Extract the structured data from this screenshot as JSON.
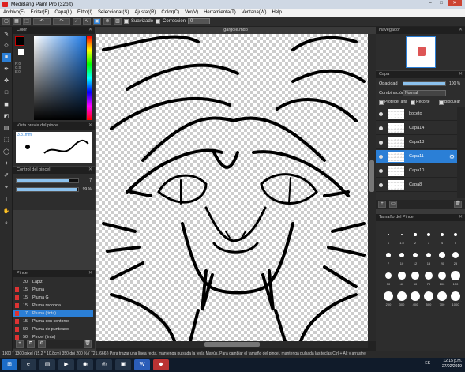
{
  "window": {
    "title": "MediBang Paint Pro (32bit)",
    "controls": [
      "–",
      "□",
      "✕"
    ]
  },
  "menu": [
    "Archivo(F)",
    "Editar(E)",
    "Capa(L)",
    "Filtro(I)",
    "Seleccionar(S)",
    "Ajustar(R)",
    "Color(C)",
    "Ver(V)",
    "Herramienta(T)",
    "Ventana(W)",
    "Help"
  ],
  "toolbar": {
    "smooth_label": "Suavizado",
    "correction_label": "Corrección",
    "correction_value": "0"
  },
  "color_panel": {
    "title": "Color",
    "hex_lines": [
      "R:0",
      "G:0",
      "B:0"
    ],
    "main_color": "#000000",
    "sub_color": "#ffffff"
  },
  "brush_preview": {
    "title": "Vista previa del pincel",
    "size": "3.31mm"
  },
  "brush_control": {
    "title": "Control del pincel",
    "size_value": "7",
    "opacity_value": "99 %",
    "size_fraction": 0.85,
    "opacity_fraction": 0.99
  },
  "brush_list": {
    "title": "Pincel",
    "items": [
      {
        "size": "20",
        "name": "Lápiz",
        "color": "#2b2b2b"
      },
      {
        "size": "15",
        "name": "Pluma",
        "color": "#d33"
      },
      {
        "size": "15",
        "name": "Pluma G",
        "color": "#d33"
      },
      {
        "size": "15",
        "name": "Pluma redonda",
        "color": "#d33"
      },
      {
        "size": "7",
        "name": "Pluma (tinta)",
        "color": "#d33",
        "selected": true
      },
      {
        "size": "15",
        "name": "Pluma con contorno",
        "color": "#d33"
      },
      {
        "size": "50",
        "name": "Pluma de punteado",
        "color": "#d33"
      },
      {
        "size": "50",
        "name": "Pincel (tinta)",
        "color": "#d33"
      }
    ]
  },
  "document": {
    "tab": "gargole.mdp"
  },
  "navigator": {
    "title": "Navegador"
  },
  "layers": {
    "title": "Capa",
    "opacity_label": "Opacidad",
    "opacity_value": "100 %",
    "opacity_fraction": 1.0,
    "blend_label": "Combinación",
    "blend_value": "Normal",
    "protect_alpha": "Proteger alfa",
    "clip": "Recorte",
    "lock": "Bloquear",
    "items": [
      {
        "name": "boceto"
      },
      {
        "name": "Capa14"
      },
      {
        "name": "Capa13"
      },
      {
        "name": "Capa11",
        "selected": true
      },
      {
        "name": "Capa10"
      },
      {
        "name": "Capa8"
      }
    ]
  },
  "brush_size": {
    "title": "Tamaño del Pincel",
    "labels": [
      "1",
      "1.5",
      "2",
      "3",
      "4",
      "5",
      "7",
      "10",
      "12",
      "15",
      "20",
      "25",
      "30",
      "40",
      "50",
      "70",
      "100",
      "150",
      "200",
      "300",
      "400",
      "500",
      "700",
      "1000"
    ]
  },
  "status": {
    "text": "1800 * 1300 pixel   (15.2 * 10.8cm)   350 dpi   200 %   ( 721, 666 )   Para trazar una línea recta, mantenga pulsada la tecla Mayús. Para cambiar el tamaño del pincel, mantenga pulsada las teclas Ctrl + Alt y arrastre"
  },
  "taskbar": {
    "lang": "ES",
    "time": "12:15 p.m.",
    "date": "27/02/2019"
  }
}
